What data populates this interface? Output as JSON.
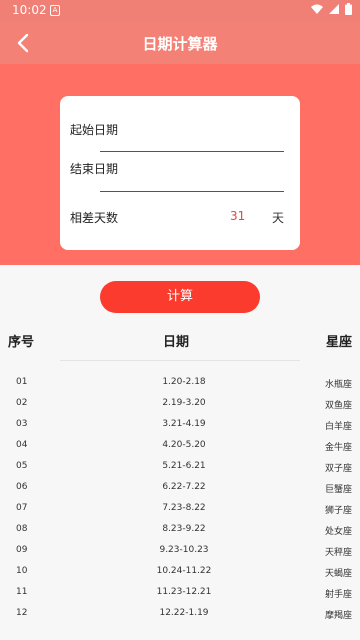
{
  "status_bar": {
    "time": "10:02",
    "notif_glyph": "A"
  },
  "app_bar": {
    "title": "日期计算器"
  },
  "form": {
    "start_label": "起始日期",
    "end_label": "结束日期",
    "diff_label": "相差天数",
    "diff_value": "31",
    "diff_unit": "天"
  },
  "calc_button": "计算",
  "table": {
    "headers": [
      "序号",
      "日期",
      "星座"
    ],
    "rows": [
      [
        "01",
        "1.20-2.18",
        "水瓶座"
      ],
      [
        "02",
        "2.19-3.20",
        "双鱼座"
      ],
      [
        "03",
        "3.21-4.19",
        "白羊座"
      ],
      [
        "04",
        "4.20-5.20",
        "金牛座"
      ],
      [
        "05",
        "5.21-6.21",
        "双子座"
      ],
      [
        "06",
        "6.22-7.22",
        "巨蟹座"
      ],
      [
        "07",
        "7.23-8.22",
        "狮子座"
      ],
      [
        "08",
        "8.23-9.22",
        "处女座"
      ],
      [
        "09",
        "9.23-10.23",
        "天秤座"
      ],
      [
        "10",
        "10.24-11.22",
        "天蝎座"
      ],
      [
        "11",
        "11.23-12.21",
        "射手座"
      ],
      [
        "12",
        "12.22-1.19",
        "摩羯座"
      ]
    ]
  },
  "colors": {
    "header": "#ff6f64",
    "accent": "#fb3b2d",
    "diff_value": "#e8463c"
  }
}
